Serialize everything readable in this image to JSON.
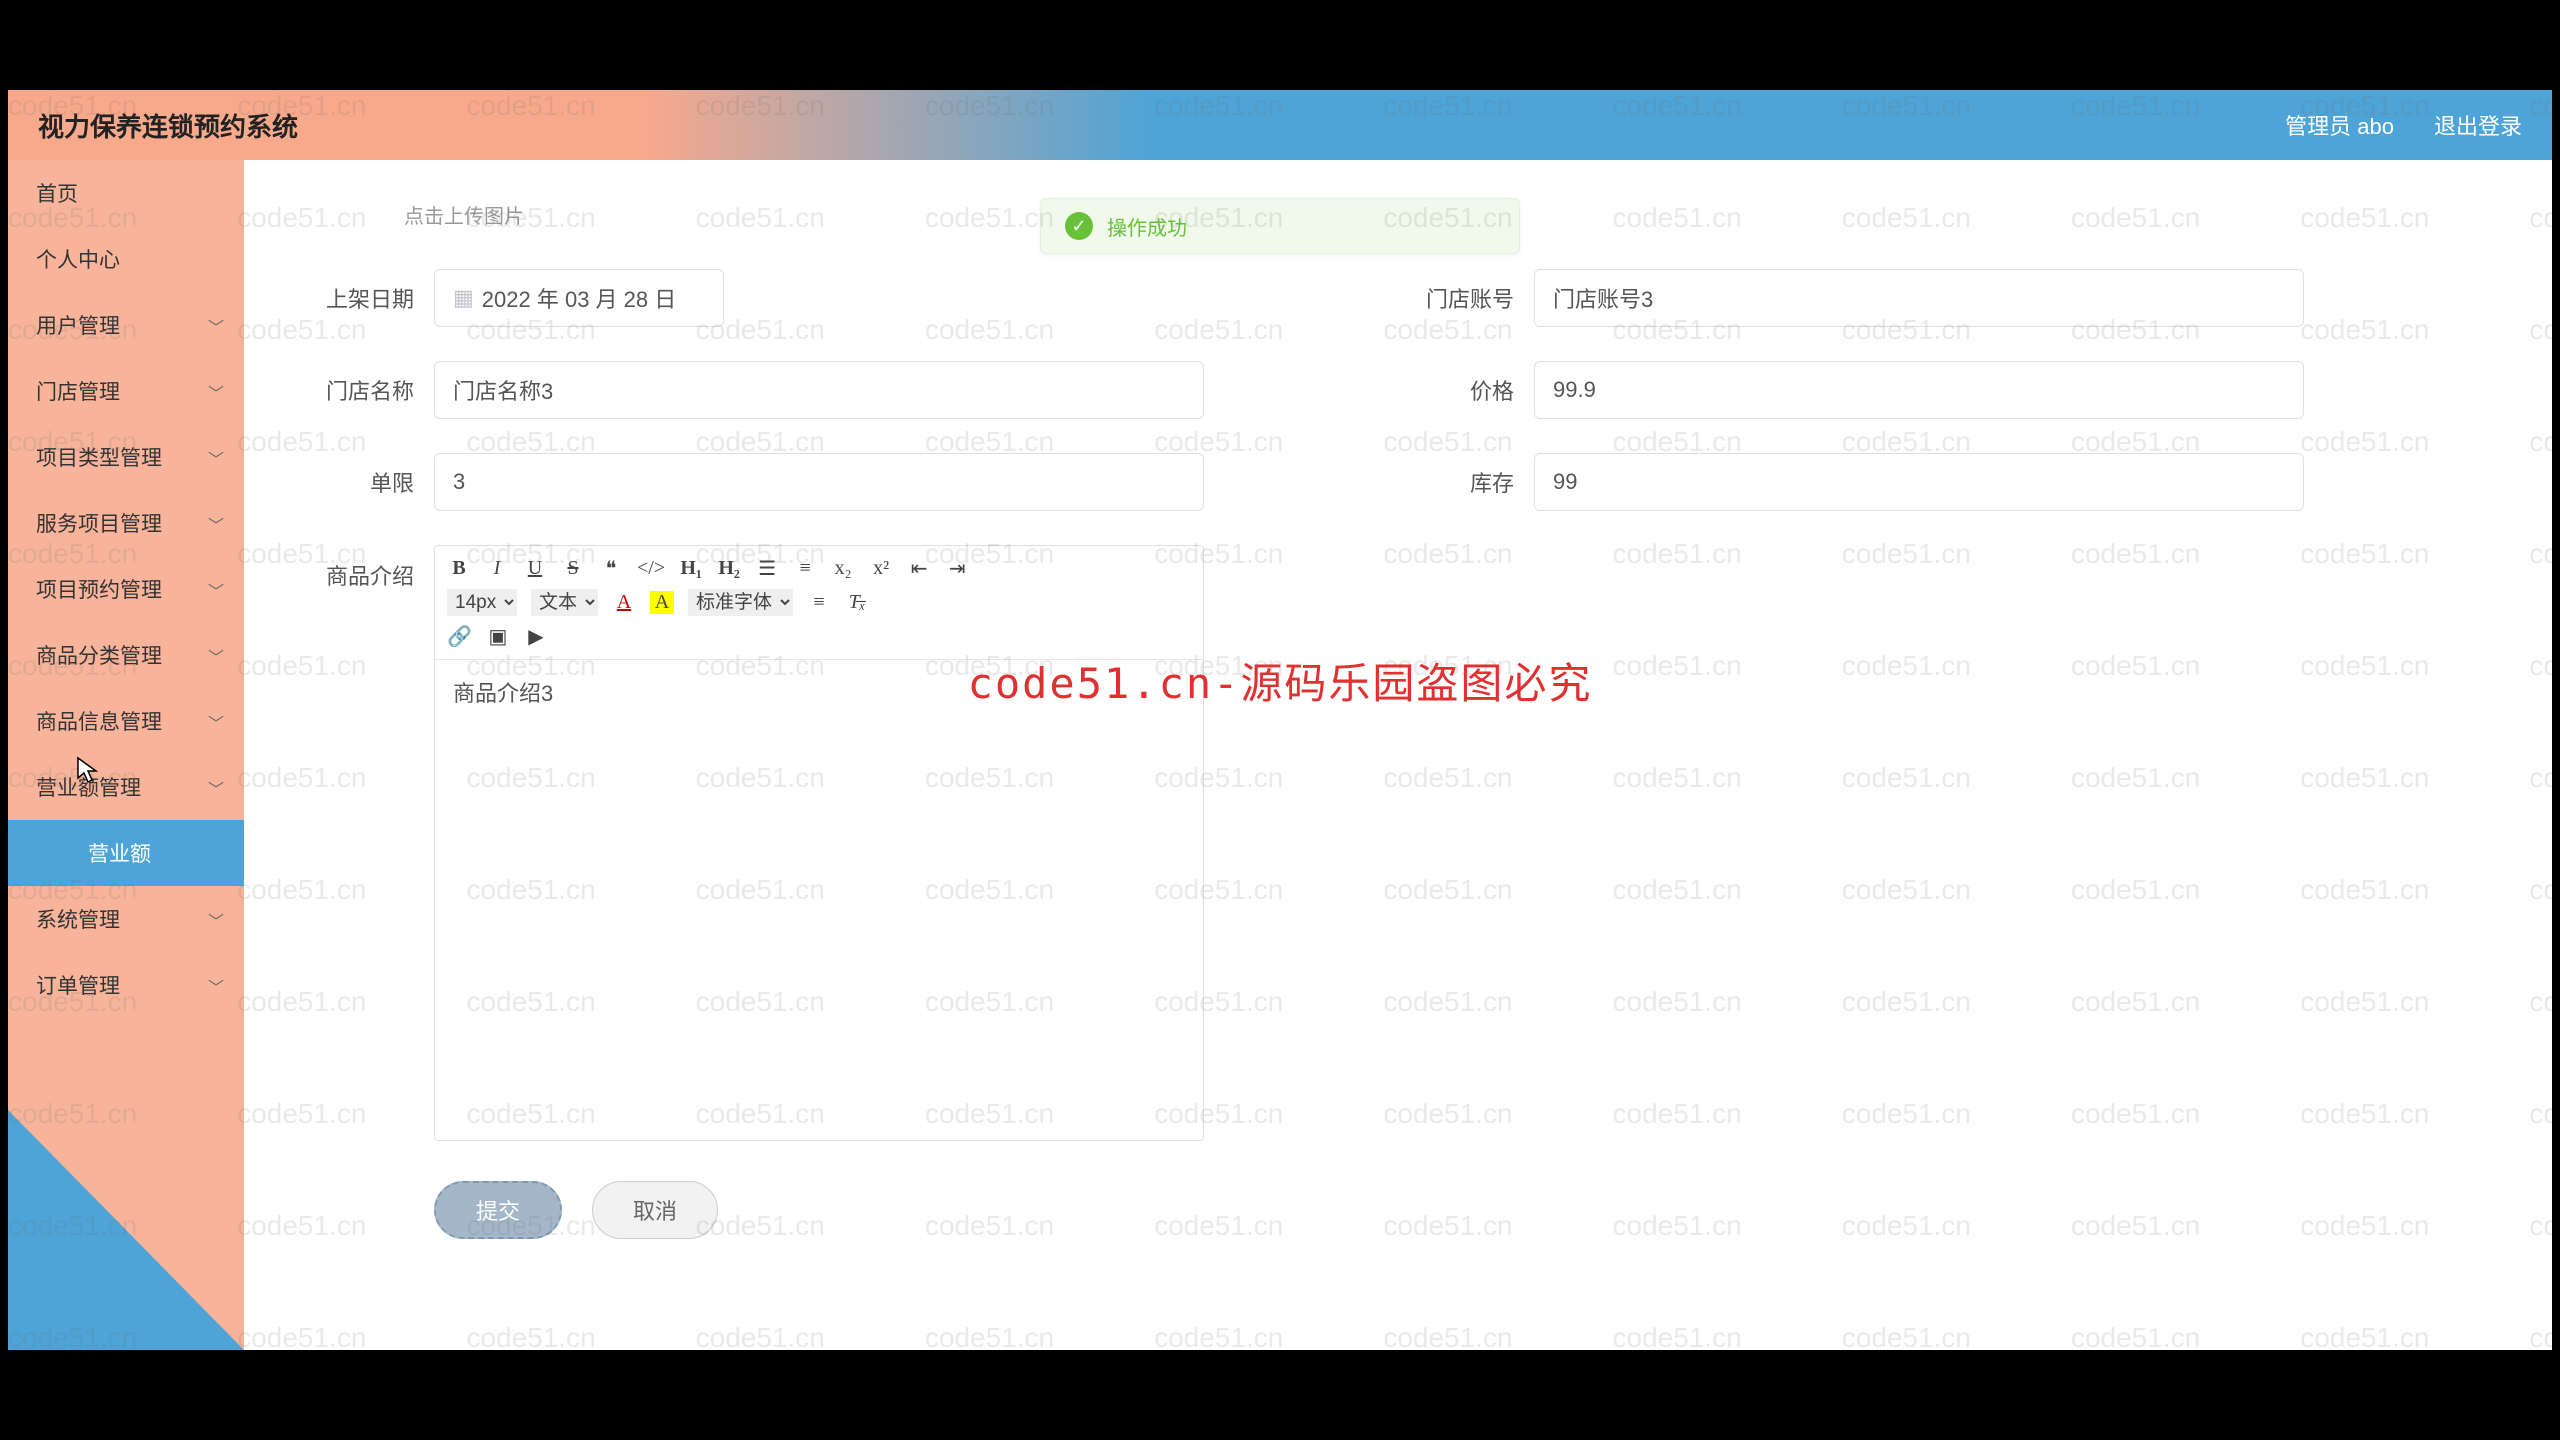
{
  "header": {
    "title": "视力保养连锁预约系统",
    "user_label": "管理员 abo",
    "logout_label": "退出登录"
  },
  "sidebar": {
    "items": [
      {
        "label": "首页",
        "expandable": false
      },
      {
        "label": "个人中心",
        "expandable": false
      },
      {
        "label": "用户管理",
        "expandable": true
      },
      {
        "label": "门店管理",
        "expandable": true
      },
      {
        "label": "项目类型管理",
        "expandable": true
      },
      {
        "label": "服务项目管理",
        "expandable": true
      },
      {
        "label": "项目预约管理",
        "expandable": true
      },
      {
        "label": "商品分类管理",
        "expandable": true
      },
      {
        "label": "商品信息管理",
        "expandable": true
      },
      {
        "label": "营业额管理",
        "expandable": true
      },
      {
        "label": "营业额",
        "expandable": false,
        "sub": true,
        "active": true
      },
      {
        "label": "系统管理",
        "expandable": true
      },
      {
        "label": "订单管理",
        "expandable": true
      }
    ]
  },
  "toast": {
    "text": "操作成功"
  },
  "form": {
    "upload_hint": "点击上传图片",
    "listing_date_label": "上架日期",
    "listing_date_value": "2022 年 03 月 28 日",
    "store_account_label": "门店账号",
    "store_account_value": "门店账号3",
    "store_name_label": "门店名称",
    "store_name_value": "门店名称3",
    "price_label": "价格",
    "price_value": "99.9",
    "single_limit_label": "单限",
    "single_limit_value": "3",
    "stock_label": "库存",
    "stock_value": "99",
    "intro_label": "商品介绍",
    "intro_value": "商品介绍3",
    "editor": {
      "font_size": "14px",
      "text_type": "文本",
      "font_family": "标准字体"
    },
    "submit_label": "提交",
    "cancel_label": "取消"
  },
  "watermark": {
    "text": "code51.cn",
    "big": "code51.cn-源码乐园盗图必究"
  }
}
